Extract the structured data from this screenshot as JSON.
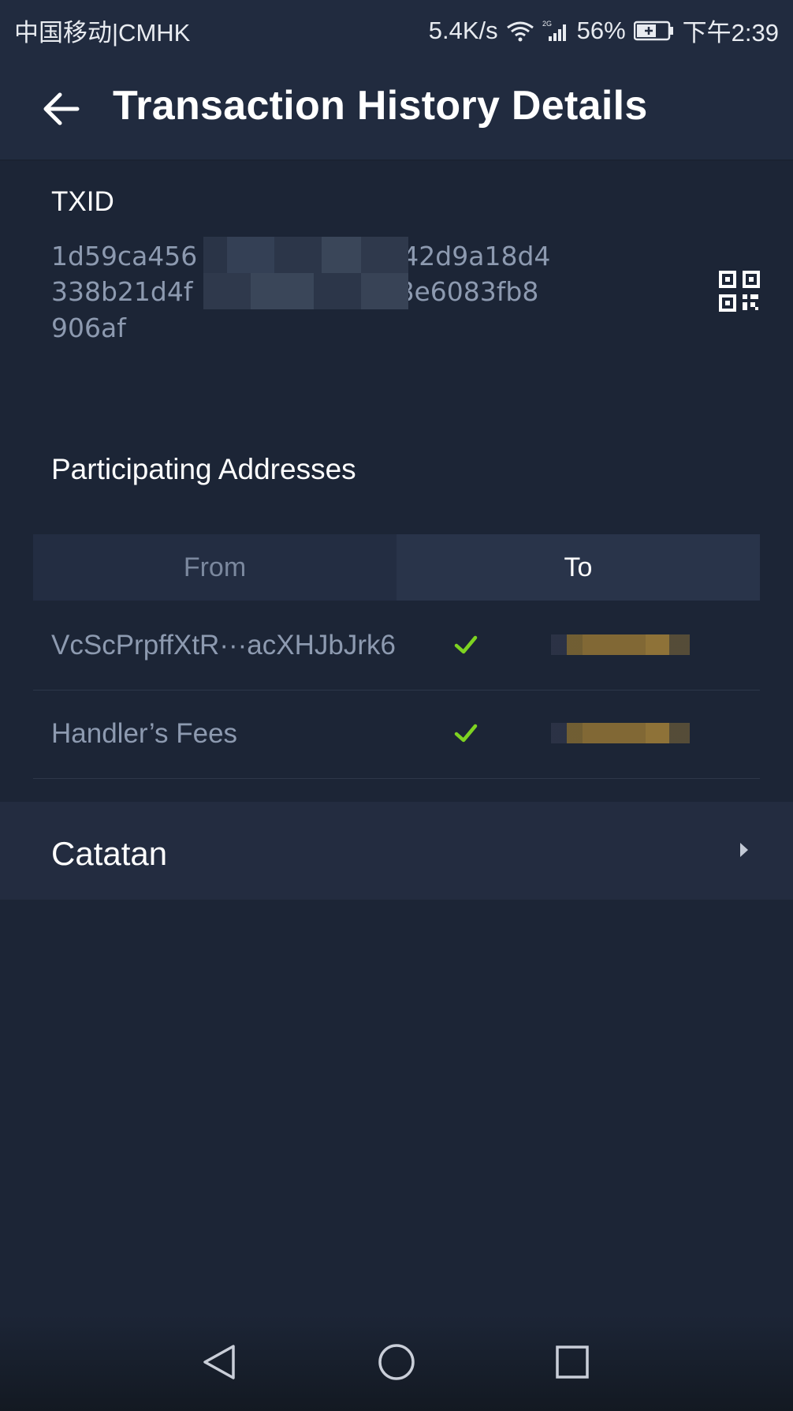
{
  "status_bar": {
    "carrier": "中国移动|CMHK",
    "net_speed": "5.4K/s",
    "signal_label": "2G",
    "battery": "56%",
    "time": "下午2:39"
  },
  "header": {
    "title": "Transaction History Details",
    "back_icon": "arrow-left-icon"
  },
  "txid": {
    "label": "TXID",
    "line1": "1d59ca456",
    "line1_end": "42d9a18d4",
    "line2": "338b21d4f",
    "line2_end": "8e6083fb8",
    "line3": "906af",
    "qr_icon": "qr-code-icon"
  },
  "participating": {
    "label": "Participating Addresses",
    "tabs": [
      "From",
      "To"
    ],
    "active_tab": "To",
    "rows": [
      {
        "address": "VcScPrpffXtR···acXHJbJrk6",
        "status_icon": "check-icon"
      },
      {
        "address": "Handler’s Fees",
        "status_icon": "check-icon"
      }
    ]
  },
  "note": {
    "label": "Catatan",
    "chevron_icon": "chevron-right-icon"
  },
  "colors": {
    "background": "#1c2536",
    "header": "#212b3f",
    "muted_text": "#8d9ab0",
    "check": "#7ed321"
  }
}
